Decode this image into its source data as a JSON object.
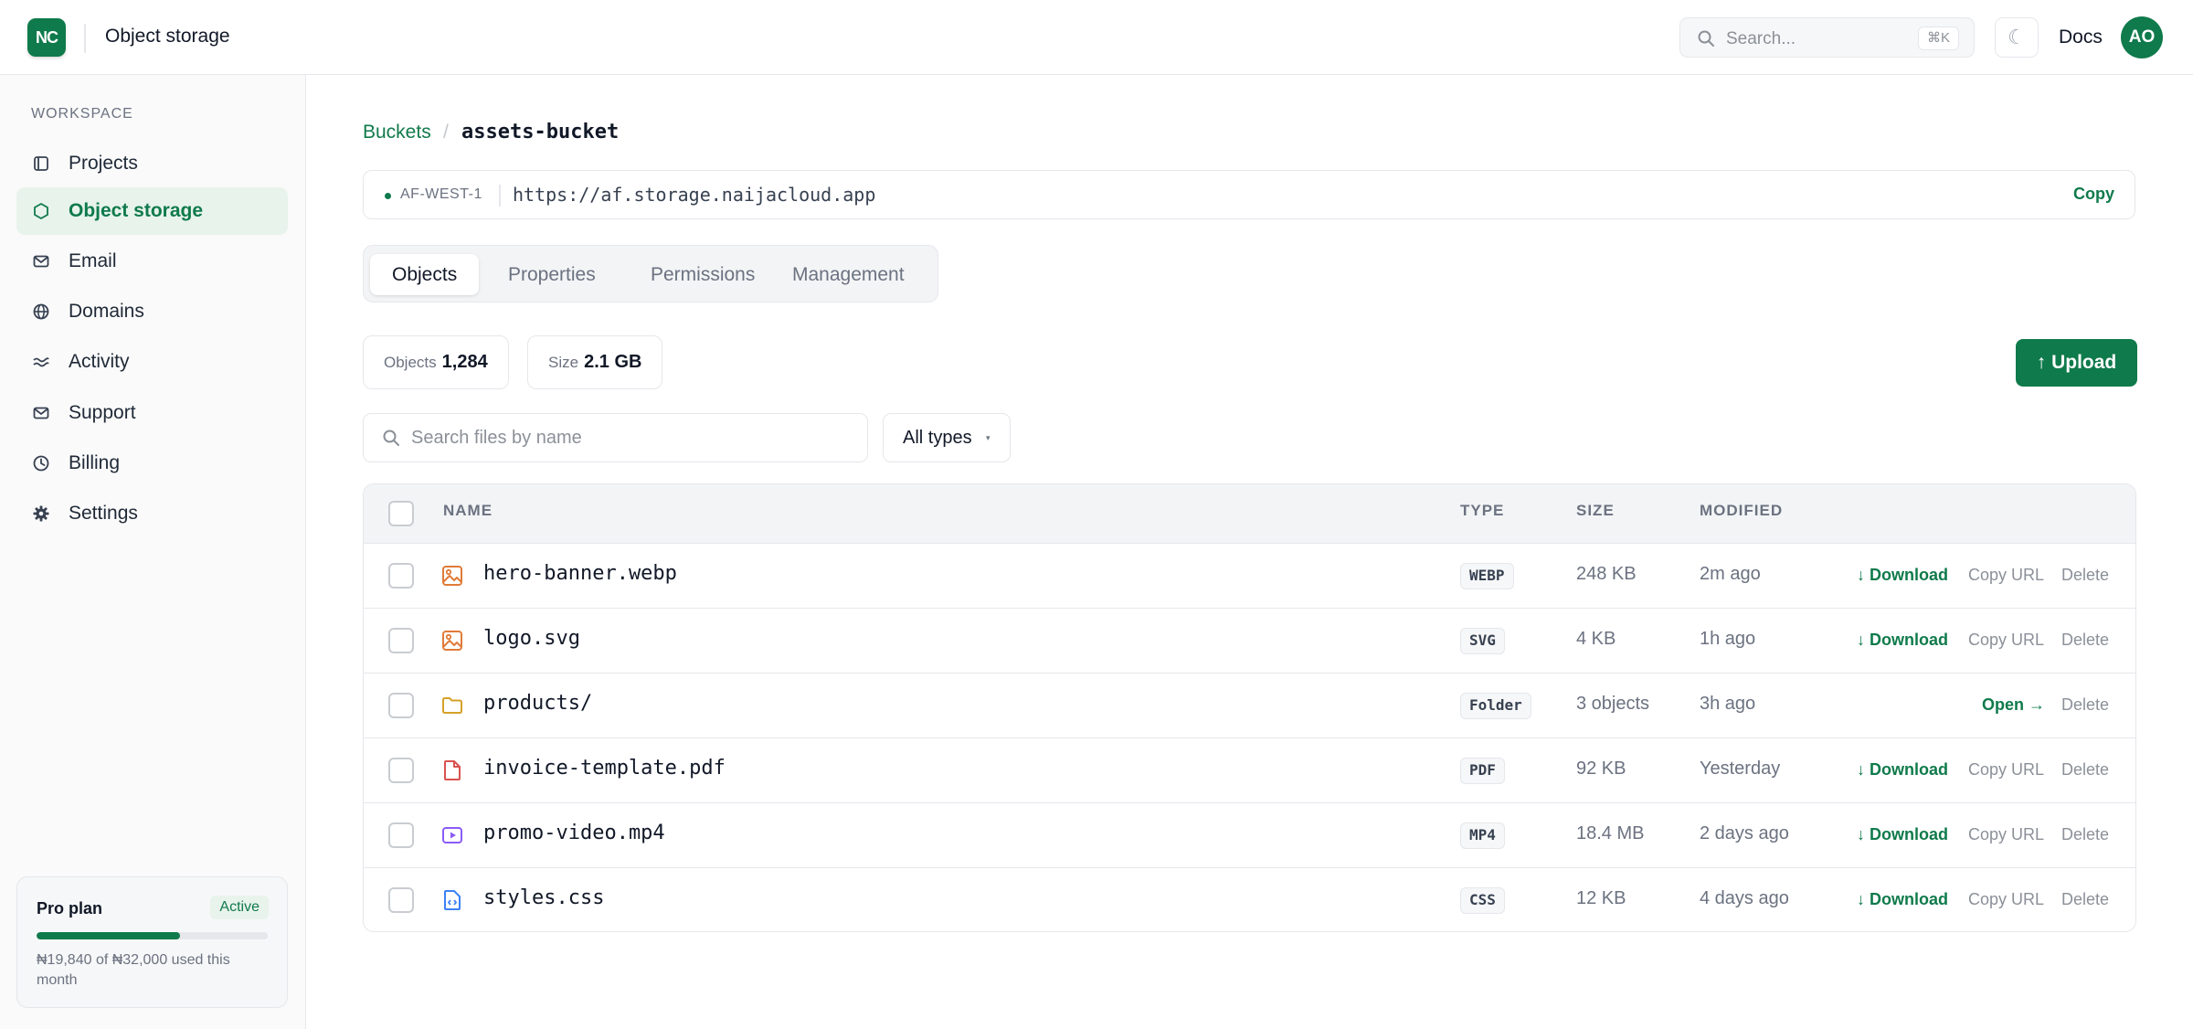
{
  "header": {
    "logo_text": "NC",
    "title": "Object storage",
    "search_placeholder": "Search...",
    "search_shortcut": "⌘K",
    "theme_icon": "☾",
    "docs_label": "Docs",
    "avatar_initials": "AO"
  },
  "sidebar": {
    "section_label": "WORKSPACE",
    "items": [
      {
        "label": "Projects",
        "icon": "projects-icon",
        "active": false
      },
      {
        "label": "Object storage",
        "icon": "storage-icon",
        "active": true
      },
      {
        "label": "Email",
        "icon": "mail-icon",
        "active": false
      },
      {
        "label": "Domains",
        "icon": "globe-icon",
        "active": false
      },
      {
        "label": "Activity",
        "icon": "activity-icon",
        "active": false
      },
      {
        "label": "Support",
        "icon": "support-icon",
        "active": false
      },
      {
        "label": "Billing",
        "icon": "clock-icon",
        "active": false
      },
      {
        "label": "Settings",
        "icon": "gear-icon",
        "active": false
      }
    ],
    "plan": {
      "title": "Pro plan",
      "badge": "Active",
      "usage_fraction": 0.62,
      "usage_text": "₦19,840 of ₦32,000 used this month"
    }
  },
  "breadcrumb": {
    "parent": "Buckets",
    "separator": "/",
    "current": "assets-bucket"
  },
  "endpoint": {
    "region": "AF-WEST-1",
    "url": "https://af.storage.naijacloud.app",
    "copy_label": "Copy"
  },
  "tabs": [
    {
      "label": "Objects",
      "active": true
    },
    {
      "label": "Properties",
      "active": false
    },
    {
      "label": "Permissions",
      "active": false
    },
    {
      "label": "Management",
      "active": false
    }
  ],
  "stats": {
    "objects_label": "Objects",
    "objects_value": "1,284",
    "size_label": "Size",
    "size_value": "2.1 GB"
  },
  "upload_label": "↑ Upload",
  "filters": {
    "search_placeholder": "Search files by name",
    "type_value": "All types",
    "type_caret": "▾"
  },
  "table": {
    "columns": [
      "NAME",
      "TYPE",
      "SIZE",
      "MODIFIED"
    ],
    "rows": [
      {
        "name": "hero-banner.webp",
        "icon": "image-icon",
        "type": "WEBP",
        "size": "248 KB",
        "modified": "2m ago",
        "download": "↓ Download",
        "copy_url": "Copy URL",
        "delete": "Delete"
      },
      {
        "name": "logo.svg",
        "icon": "image-icon",
        "type": "SVG",
        "size": "4 KB",
        "modified": "1h ago",
        "download": "↓ Download",
        "copy_url": "Copy URL",
        "delete": "Delete"
      },
      {
        "name": "products/",
        "icon": "folder-icon",
        "type": "Folder",
        "size": "3 objects",
        "modified": "3h ago",
        "open": "Open →",
        "delete": "Delete"
      },
      {
        "name": "invoice-template.pdf",
        "icon": "pdf-icon",
        "type": "PDF",
        "size": "92 KB",
        "modified": "Yesterday",
        "download": "↓ Download",
        "copy_url": "Copy URL",
        "delete": "Delete"
      },
      {
        "name": "promo-video.mp4",
        "icon": "video-icon",
        "type": "MP4",
        "size": "18.4 MB",
        "modified": "2 days ago",
        "download": "↓ Download",
        "copy_url": "Copy URL",
        "delete": "Delete"
      },
      {
        "name": "styles.css",
        "icon": "code-file-icon",
        "type": "CSS",
        "size": "12 KB",
        "modified": "4 days ago",
        "download": "↓ Download",
        "copy_url": "Copy URL",
        "delete": "Delete"
      }
    ]
  },
  "colors": {
    "brand": "#0f7a4b",
    "image_icon": "#e07b39",
    "folder_icon": "#d6a12a",
    "pdf_icon": "#d9534f",
    "video_icon": "#8b5cf6",
    "code_icon": "#3b82f6"
  }
}
